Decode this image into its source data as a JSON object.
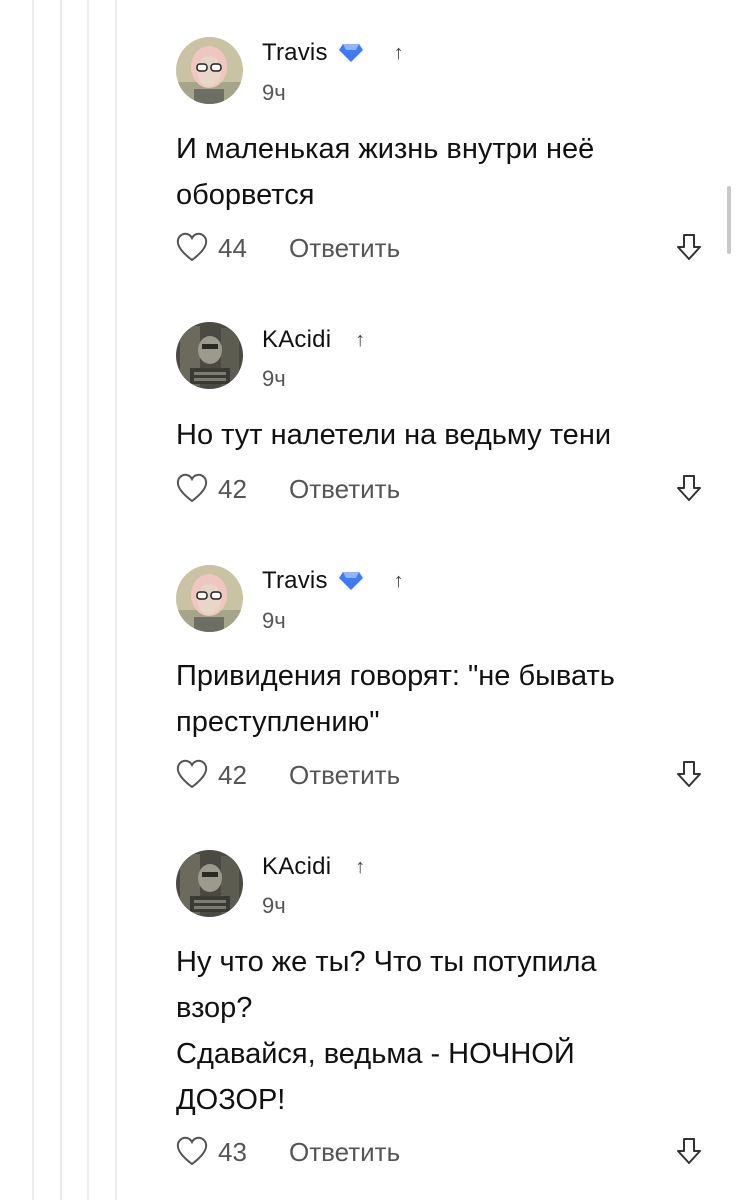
{
  "comments": [
    {
      "author": "Travis",
      "verified": true,
      "time": "9ч",
      "lines": [
        "И маленькая жизнь внутри неё",
        "оборвется"
      ],
      "likes": "44",
      "reply": "Ответить"
    },
    {
      "author": "KAcidi",
      "verified": false,
      "time": "9ч",
      "lines": [
        "Но тут налетели на ведьму тени"
      ],
      "likes": "42",
      "reply": "Ответить"
    },
    {
      "author": "Travis",
      "verified": true,
      "time": "9ч",
      "lines": [
        "Привидения говорят: \"не бывать",
        "преступлению\""
      ],
      "likes": "42",
      "reply": "Ответить"
    },
    {
      "author": "KAcidi",
      "verified": false,
      "time": "9ч",
      "lines": [
        "Ну что же ты? Что ты потупила",
        "взор?",
        "Сдавайся, ведьма - НОЧНОЙ",
        "ДОЗОР!"
      ],
      "likes": "43",
      "reply": "Ответить"
    }
  ],
  "icons": {
    "verified": "diamond-badge-icon",
    "upvote": "arrow-up-icon",
    "like": "heart-outline-icon",
    "downvote": "arrow-down-icon"
  },
  "colors": {
    "badge": "#3d7bf5",
    "muted_text": "#555555",
    "thread_line": "#ececec"
  }
}
